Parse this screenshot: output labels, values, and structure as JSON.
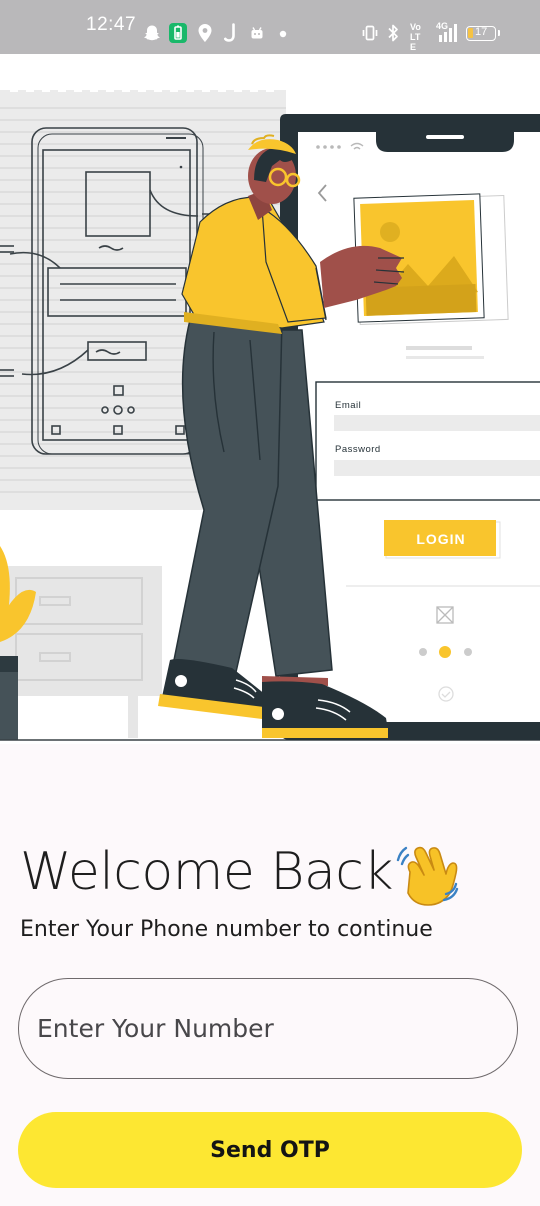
{
  "status_bar": {
    "time": "12:47",
    "battery": "17",
    "network": "4G",
    "volte": "Vo LTE"
  },
  "illustration": {
    "email_label": "Email",
    "password_label": "Password",
    "login_label": "LOGIN"
  },
  "login": {
    "title": "Welcome Back",
    "subtitle": "Enter Your Phone number to continue",
    "phone_placeholder": "Enter Your Number",
    "send_otp_label": "Send OTP"
  },
  "colors": {
    "accent_yellow": "#fde732",
    "illustration_yellow": "#f9c52d",
    "dark_slate": "#455258"
  }
}
